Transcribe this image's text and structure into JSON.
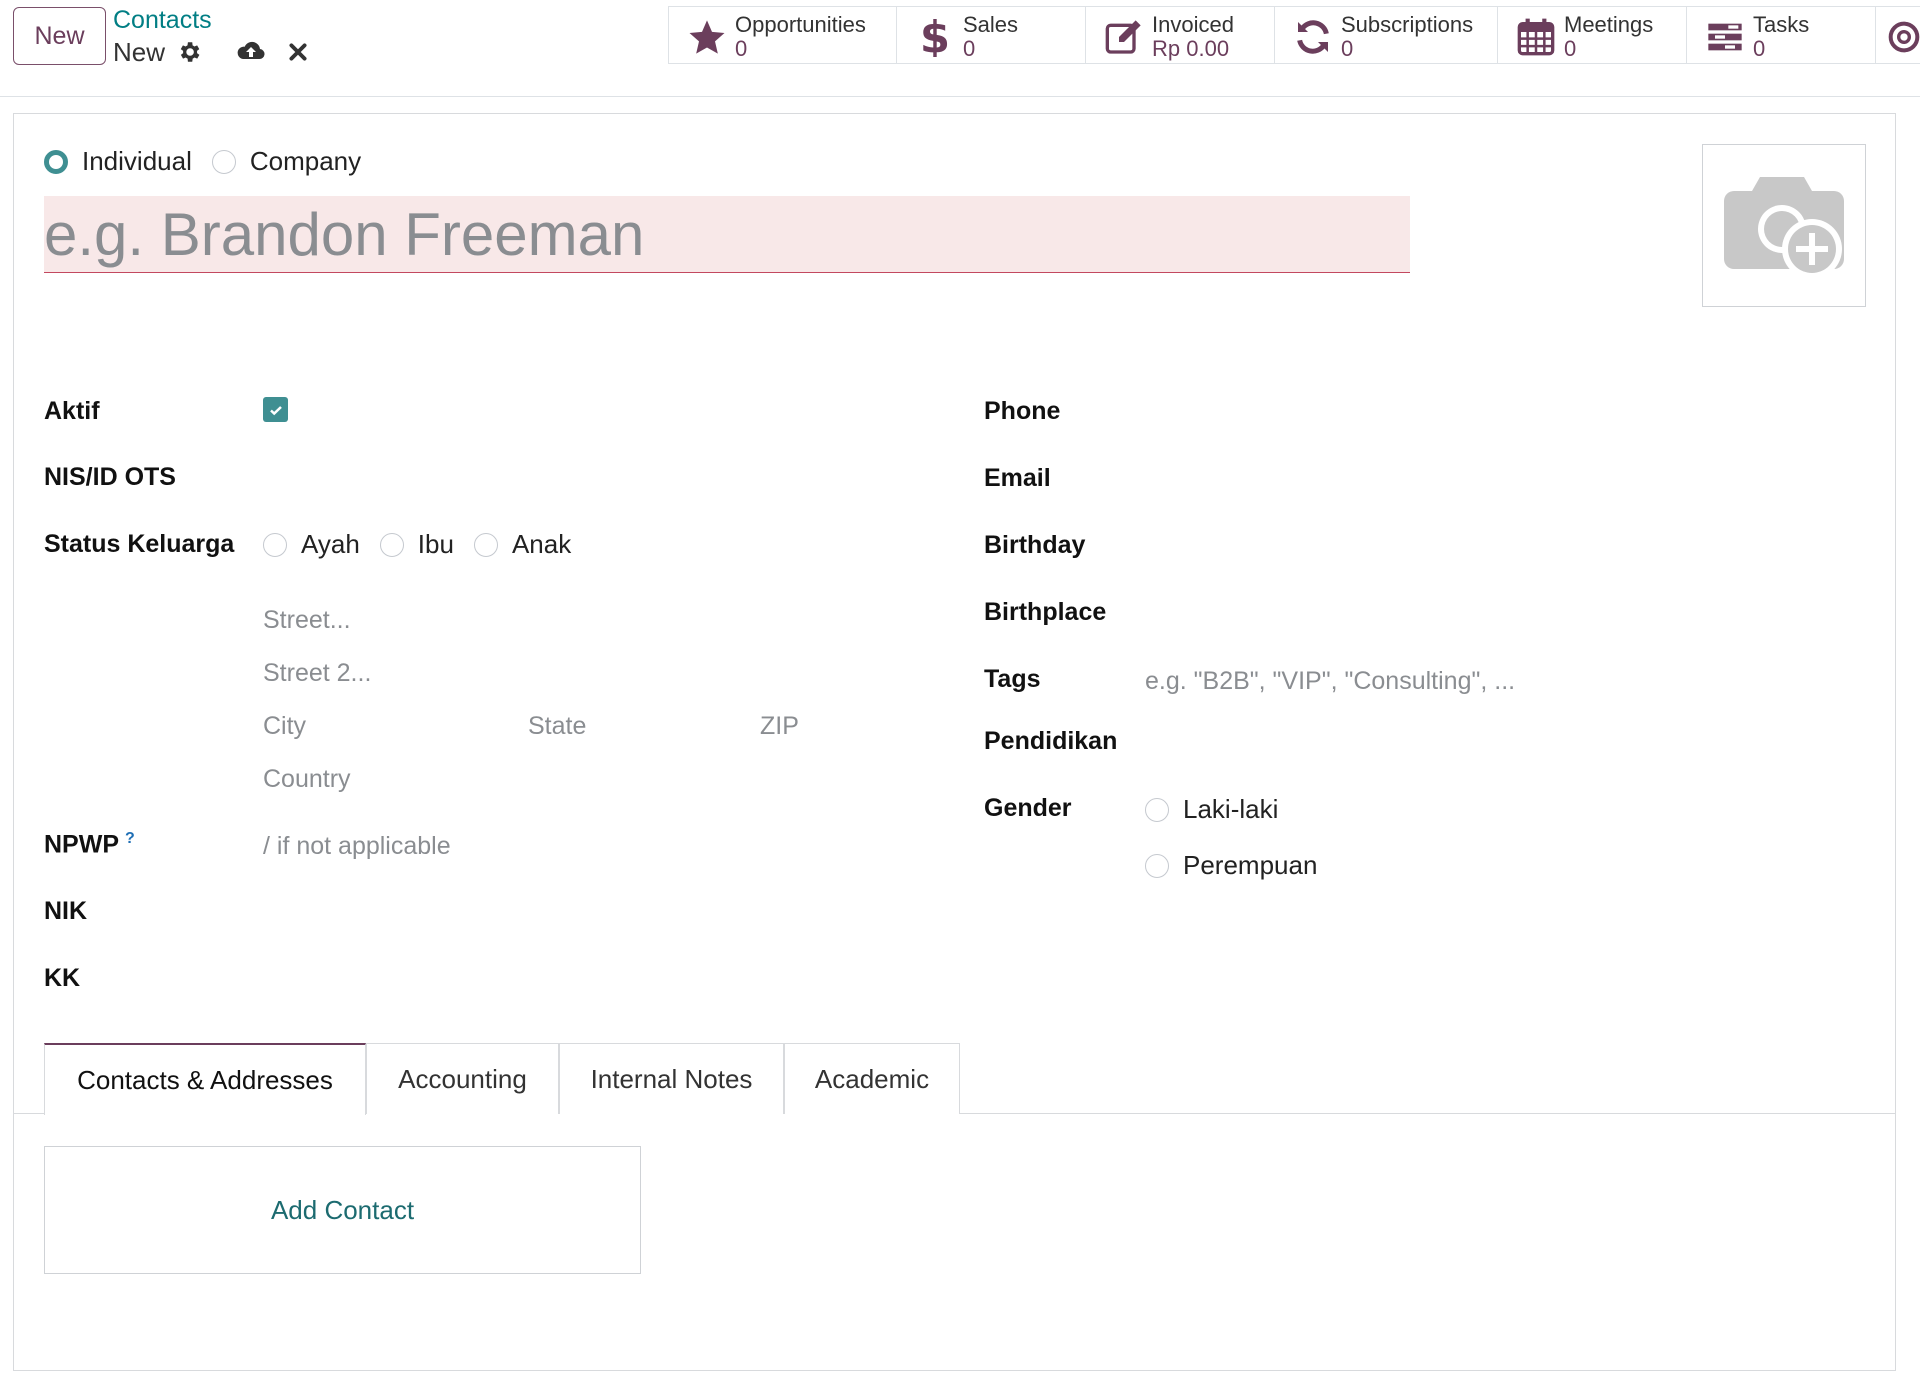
{
  "control_panel": {
    "new_button": "New",
    "breadcrumb_parent": "Contacts",
    "breadcrumb_current": "New"
  },
  "smart_buttons": [
    {
      "label": "Opportunities",
      "value": "0",
      "icon": "star-icon"
    },
    {
      "label": "Sales",
      "value": "0",
      "icon": "dollar-icon"
    },
    {
      "label": "Invoiced",
      "value": "Rp 0.00",
      "icon": "pencil-square-icon"
    },
    {
      "label": "Subscriptions",
      "value": "0",
      "icon": "refresh-icon"
    },
    {
      "label": "Meetings",
      "value": "0",
      "icon": "calendar-icon"
    },
    {
      "label": "Tasks",
      "value": "0",
      "icon": "tasks-icon"
    }
  ],
  "form": {
    "type_individual": "Individual",
    "type_company": "Company",
    "name_placeholder": "e.g. Brandon Freeman",
    "labels": {
      "aktif": "Aktif",
      "nis": "NIS/ID OTS",
      "status_keluarga": "Status Keluarga",
      "npwp": "NPWP",
      "npwp_help": "?",
      "nik": "NIK",
      "kk": "KK",
      "phone": "Phone",
      "email": "Email",
      "birthday": "Birthday",
      "birthplace": "Birthplace",
      "tags": "Tags",
      "pendidikan": "Pendidikan",
      "gender": "Gender"
    },
    "status_options": [
      "Ayah",
      "Ibu",
      "Anak"
    ],
    "address_placeholders": {
      "street": "Street...",
      "street2": "Street 2...",
      "city": "City",
      "state": "State",
      "zip": "ZIP",
      "country": "Country"
    },
    "npwp_placeholder": "/ if not applicable",
    "tags_placeholder": "e.g. \"B2B\", \"VIP\", \"Consulting\", ...",
    "gender_options": [
      "Laki-laki",
      "Perempuan"
    ]
  },
  "tabs": [
    "Contacts & Addresses",
    "Accounting",
    "Internal Notes",
    "Academic"
  ],
  "add_contact_label": "Add Contact",
  "colors": {
    "brand": "#6b3e5c",
    "accent": "#017e84",
    "checkbox": "#3f8f92",
    "required_bg": "#f8e8e8",
    "required_border": "#c3485f"
  }
}
